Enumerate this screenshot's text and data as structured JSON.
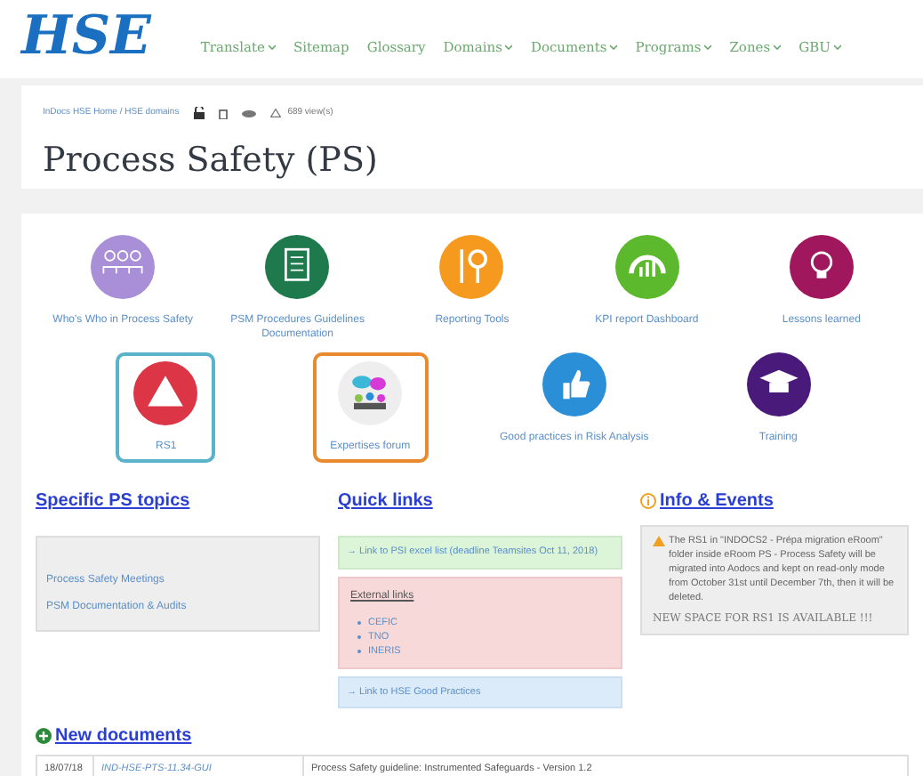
{
  "logo": "HSE",
  "nav": [
    {
      "label": "Translate",
      "dropdown": true
    },
    {
      "label": "Sitemap",
      "dropdown": false
    },
    {
      "label": "Glossary",
      "dropdown": false
    },
    {
      "label": "Domains",
      "dropdown": true
    },
    {
      "label": "Documents",
      "dropdown": true
    },
    {
      "label": "Programs",
      "dropdown": true
    },
    {
      "label": "Zones",
      "dropdown": true
    },
    {
      "label": "GBU",
      "dropdown": true
    }
  ],
  "breadcrumb": "InDocs HSE Home / HSE domains",
  "views": "689 view(s)",
  "title": "Process Safety (PS)",
  "tiles": [
    {
      "label": "Who's Who in Process Safety",
      "kind": "people",
      "color": "#a98fd8"
    },
    {
      "label": "PSM Procedures Guidelines Documentation",
      "kind": "clipboard",
      "color": "#1e7a4c"
    },
    {
      "label": "Reporting Tools",
      "kind": "tools",
      "color": "#f59a1f"
    },
    {
      "label": "KPI report Dashboard",
      "kind": "gauge",
      "color": "#5cb82c"
    },
    {
      "label": "Lessons learned",
      "kind": "bulb",
      "color": "#a0175e"
    }
  ],
  "tiles_2": [
    {
      "label": "RS1",
      "kind": "triangle",
      "color": "#dc3545",
      "framed": true
    },
    {
      "label": "Expertises forum",
      "kind": "forum",
      "color": "#eeeeee",
      "framed": true
    },
    {
      "label": "Good practices in Risk Analysis",
      "kind": "thumb",
      "color": "#2a8fd6",
      "framed": false
    },
    {
      "label": "Training",
      "kind": "cap",
      "color": "#4a1a7a",
      "framed": false
    }
  ],
  "topics": {
    "heading": "Specific PS topics",
    "items": [
      "Process Safety Meetings",
      "PSM Documentation & Audits"
    ]
  },
  "quick_links": {
    "heading": "Quick links",
    "psi_link": "→ Link to PSI excel list (deadline Teamsites Oct 11, 2018)",
    "external_heading": "External links",
    "external": [
      "CEFIC",
      "TNO",
      "INERIS"
    ],
    "good_practices_link": "→ Link to HSE Good Practices"
  },
  "info": {
    "heading": "Info & Events",
    "message": "The RS1 in \"INDOCS2 - Prépa migration eRoom\" folder inside eRoom PS - Process Safety will be migrated into Aodocs and kept on read-only mode from October 31st until December 7th, then it will be deleted.",
    "announcement": "NEW SPACE FOR RS1 IS AVAILABLE !!!"
  },
  "new_documents": {
    "heading": "New documents",
    "rows": [
      {
        "date": "18/07/18",
        "reference": "IND-HSE-PTS-11.34-GUI",
        "description": "Process Safety guideline: Instrumented Safeguards - Version 1.2"
      }
    ]
  }
}
